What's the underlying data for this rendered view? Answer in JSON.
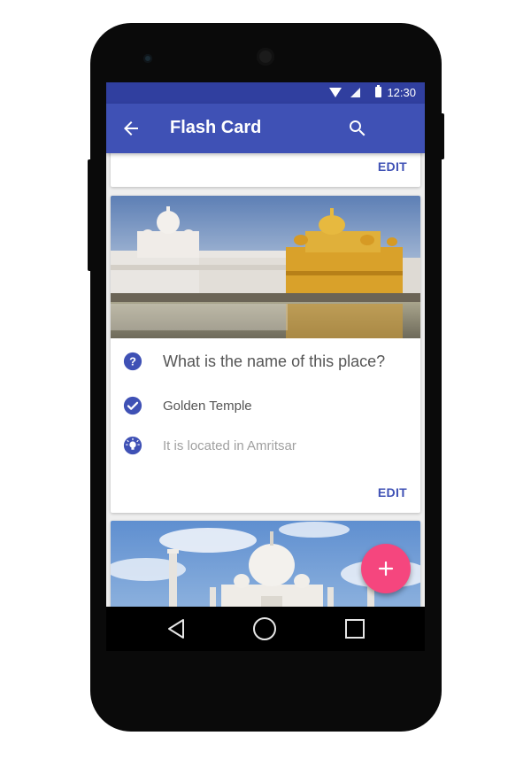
{
  "status_bar": {
    "time": "12:30"
  },
  "app_bar": {
    "title": "Flash Card"
  },
  "cards": [
    {
      "edit_label": "EDIT"
    },
    {
      "question": "What is the name of this place?",
      "answer": "Golden Temple",
      "hint": "It is located in Amritsar",
      "edit_label": "EDIT"
    }
  ],
  "fab": {
    "label": "+"
  },
  "colors": {
    "primary": "#3f51b5",
    "primary_dark": "#303f9f",
    "accent": "#f5467e"
  },
  "icons": [
    "back-arrow-icon",
    "search-icon",
    "question-icon",
    "check-icon",
    "lightbulb-icon",
    "plus-icon",
    "nav-back-icon",
    "nav-home-icon",
    "nav-recent-icon"
  ]
}
